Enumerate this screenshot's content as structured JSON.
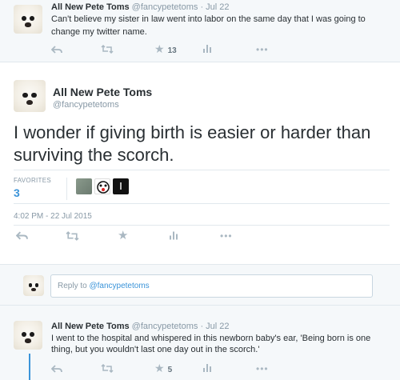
{
  "tweet1": {
    "name": "All New Pete Toms",
    "handle": "@fancypetetoms",
    "date": "· Jul 22",
    "text": "Can't believe my sister in law went into labor on the same day that I was going to change my twitter name.",
    "favorites": "13"
  },
  "main": {
    "name": "All New Pete Toms",
    "handle": "@fancypetetoms",
    "text": "I wonder if giving birth is easier or harder than surviving the scorch.",
    "favorites_label": "FAVORITES",
    "favorites_count": "3",
    "timestamp": "4:02 PM - 22 Jul 2015"
  },
  "reply": {
    "prefix": "Reply to",
    "mention": "@fancypetetoms"
  },
  "tweet3": {
    "name": "All New Pete Toms",
    "handle": "@fancypetetoms",
    "date": "· Jul 22",
    "text": "I went to the hospital and whispered in this newborn baby's ear, 'Being born is one thing, but you wouldn't last one day out in the scorch.'",
    "favorites": "5"
  },
  "icons": {
    "reply": "reply-icon",
    "retweet": "retweet-icon",
    "favorite": "star-icon",
    "stats": "stats-icon",
    "more": "more-icon"
  },
  "colors": {
    "accent": "#3b94d9",
    "muted": "#8899a6",
    "icon": "#aab8c2",
    "background": "#f5f8fa"
  }
}
